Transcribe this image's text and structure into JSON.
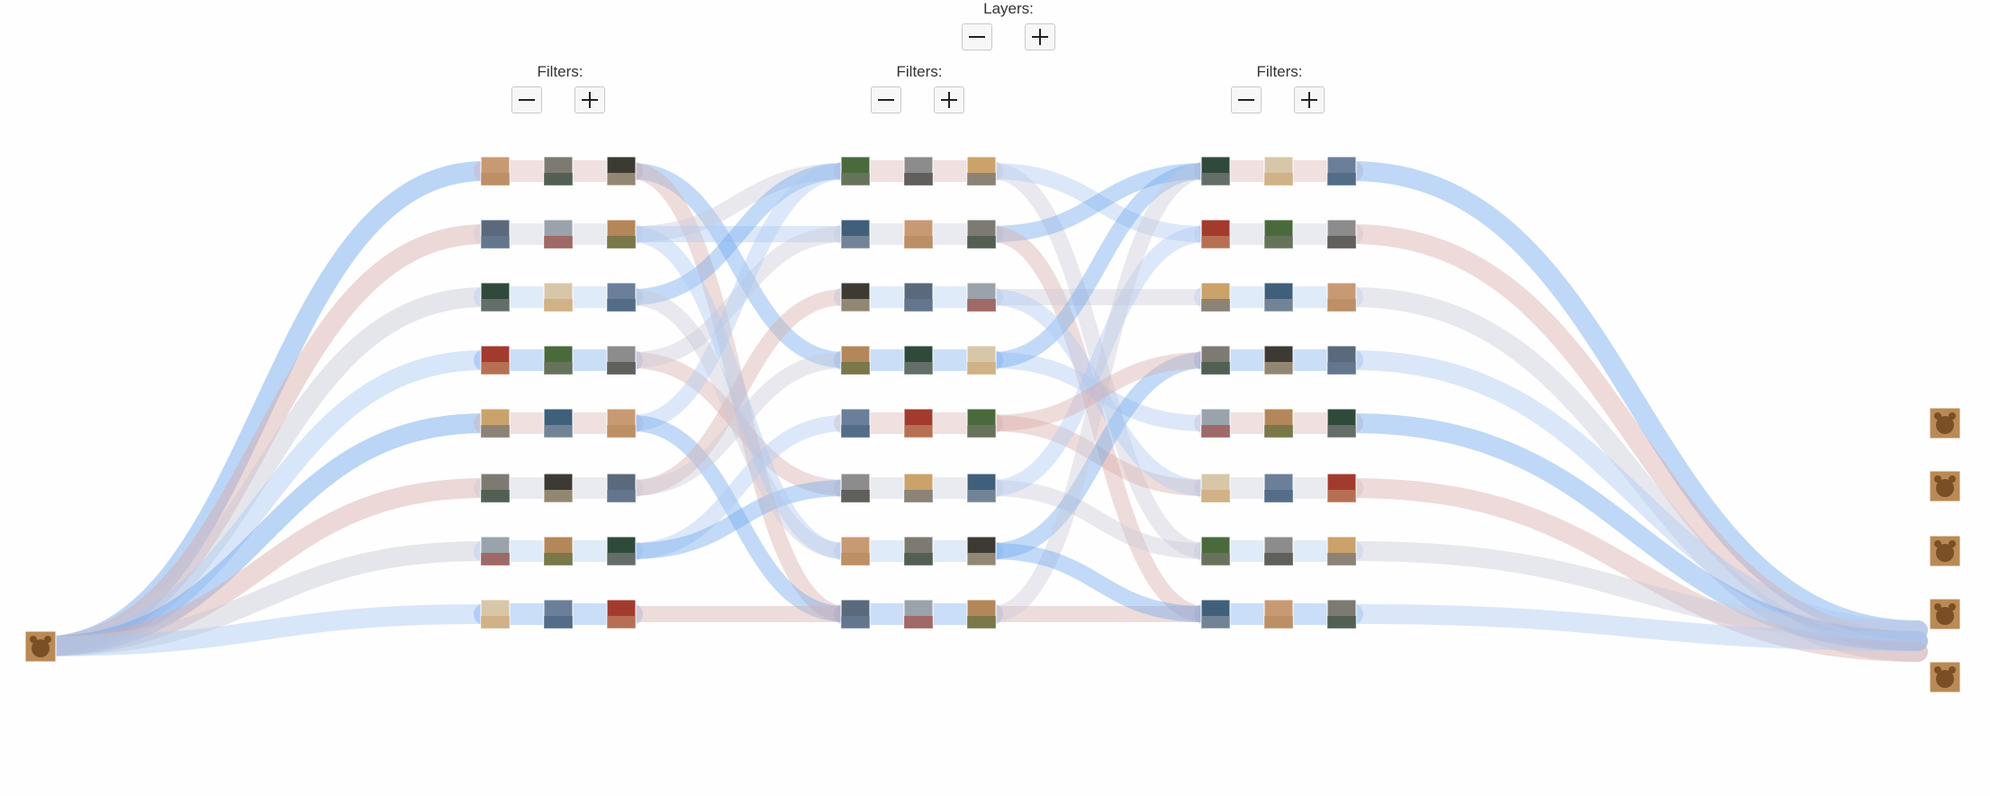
{
  "controls": {
    "layers_label": "Layers:",
    "filters_label": "Filters:"
  },
  "colors": {
    "background": "#fefefe",
    "flow_blue": "#6aa4ee",
    "flow_blue_light": "#a9c9f2",
    "flow_rose": "#d8aaa8",
    "flow_gray": "#c7c8d8"
  },
  "icons": {
    "minus": "minus-icon",
    "plus": "plus-icon"
  },
  "network": {
    "input_image": "bear-photo",
    "output_images": [
      "bear-photo",
      "bear-photo",
      "bear-photo",
      "bear-photo",
      "bear-photo"
    ],
    "layers": [
      {
        "filter_count": 8,
        "images_per_filter": 3
      },
      {
        "filter_count": 8,
        "images_per_filter": 3
      },
      {
        "filter_count": 8,
        "images_per_filter": 3
      }
    ]
  }
}
